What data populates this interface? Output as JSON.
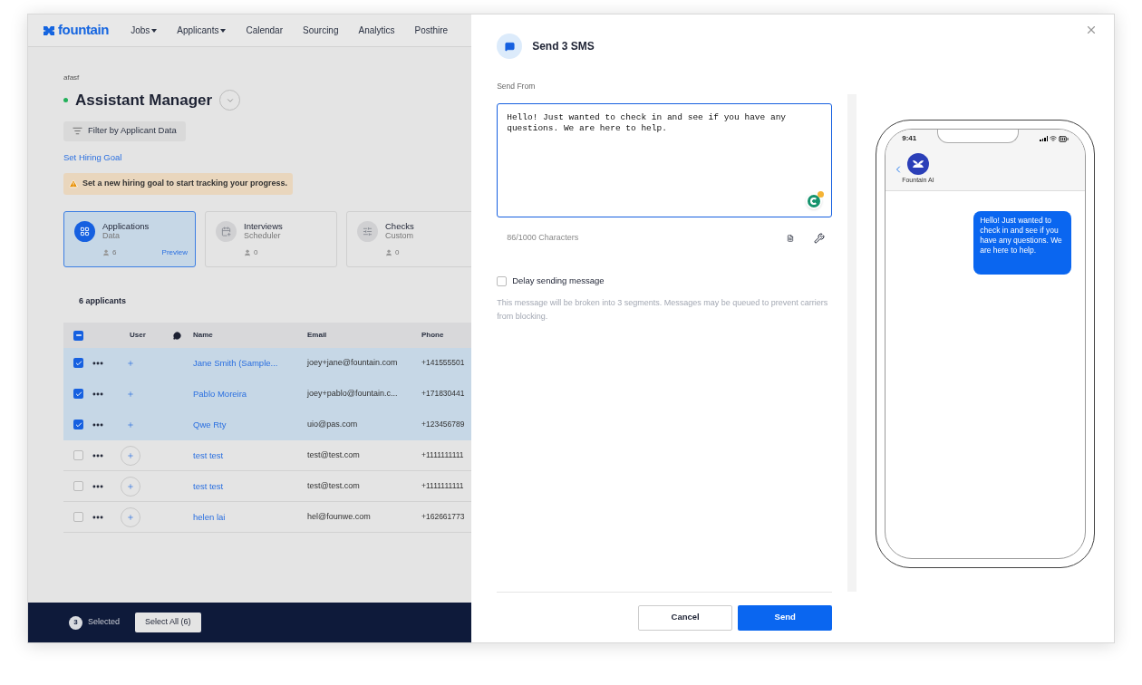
{
  "nav": {
    "logo": "fountain",
    "items": [
      {
        "label": "Jobs",
        "dropdown": true
      },
      {
        "label": "Applicants",
        "dropdown": true
      },
      {
        "label": "Calendar",
        "dropdown": false
      },
      {
        "label": "Sourcing",
        "dropdown": false
      },
      {
        "label": "Analytics",
        "dropdown": false
      },
      {
        "label": "Posthire",
        "dropdown": false
      }
    ]
  },
  "breadcrumb": "afasf",
  "title": "Assistant Manager",
  "filter_button": "Filter by Applicant Data",
  "goal_link": "Set Hiring Goal",
  "alert": "Set a new hiring goal to start tracking your progress.",
  "cards": [
    {
      "title": "Applications",
      "subtitle": "Data",
      "count": "6",
      "link": "Preview",
      "selected": true
    },
    {
      "title": "Interviews",
      "subtitle": "Scheduler",
      "count": "0",
      "selected": false
    },
    {
      "title": "Checks",
      "subtitle": "Custom",
      "count": "0",
      "selected": false
    }
  ],
  "applicants_count": "6 applicants",
  "table": {
    "indeterminate": true,
    "columns": [
      "User",
      "Name",
      "Email",
      "Phone"
    ],
    "rows": [
      {
        "selected": true,
        "name": "Jane Smith (Sample...",
        "email": "joey+jane@fountain.com",
        "phone": "+141555501"
      },
      {
        "selected": true,
        "name": "Pablo Moreira",
        "email": "joey+pablo@fountain.c...",
        "phone": "+171830441"
      },
      {
        "selected": true,
        "name": "Qwe Rty",
        "email": "uio@pas.com",
        "phone": "+123456789"
      },
      {
        "selected": false,
        "name": "test test",
        "email": "test@test.com",
        "phone": "+1111111111"
      },
      {
        "selected": false,
        "name": "test test",
        "email": "test@test.com",
        "phone": "+1111111111"
      },
      {
        "selected": false,
        "name": "helen lai",
        "email": "hel@founwe.com",
        "phone": "+162661773"
      }
    ]
  },
  "bottom_bar": {
    "count": "3",
    "label": "Selected",
    "button": "Select All (6)"
  },
  "modal": {
    "title": "Send 3 SMS",
    "send_from_label": "Send From",
    "message": "Hello! Just wanted to check in and see if you have any questions. We are here to help.",
    "char_count": "86/1000 Characters",
    "delay": {
      "label": "Delay sending message",
      "checked": false
    },
    "note": "This message will be broken into 3 segments. Messages may be queued to prevent carriers from blocking.",
    "phone": {
      "time": "9:41",
      "contact": "Fountain AI",
      "bubble": "Hello! Just wanted to check in and see if you have any questions. We are here to help."
    },
    "buttons": {
      "cancel": "Cancel",
      "send": "Send"
    }
  }
}
